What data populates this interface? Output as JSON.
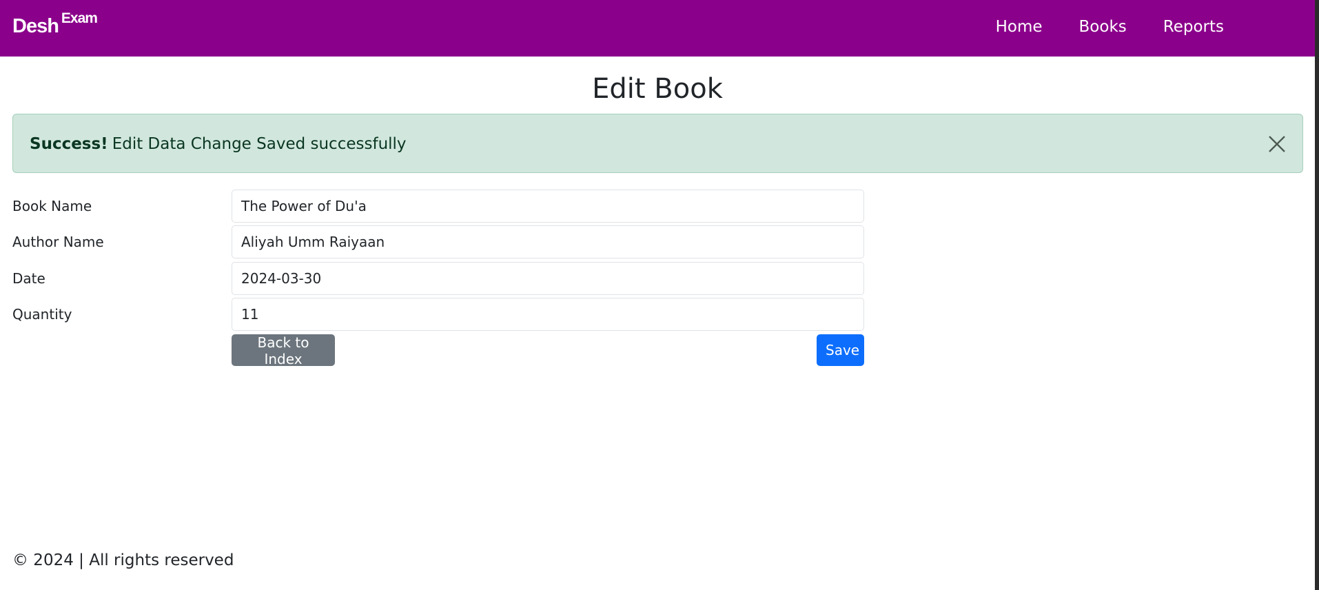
{
  "brand": {
    "name": "Desh",
    "sup": "Exam"
  },
  "nav": {
    "items": [
      "Home",
      "Books",
      "Reports"
    ]
  },
  "page": {
    "title": "Edit Book"
  },
  "alert": {
    "strong": "Success!",
    "message": "Edit Data Change Saved successfully",
    "close_icon": "close-icon"
  },
  "form": {
    "book_name": {
      "label": "Book Name",
      "value": "The Power of Du'a"
    },
    "author_name": {
      "label": "Author Name",
      "value": "Aliyah Umm Raiyaan"
    },
    "date": {
      "label": "Date",
      "value": "2024-03-30"
    },
    "quantity": {
      "label": "Quantity",
      "value": "11"
    }
  },
  "buttons": {
    "back_label": "Back to Index",
    "save_label": "Save"
  },
  "footer": {
    "text": "© 2024 | All rights reserved"
  },
  "colors": {
    "navbar": "#8b008b",
    "alert_bg": "#d1e7dd",
    "primary": "#0d6efd",
    "secondary": "#6c757d"
  }
}
